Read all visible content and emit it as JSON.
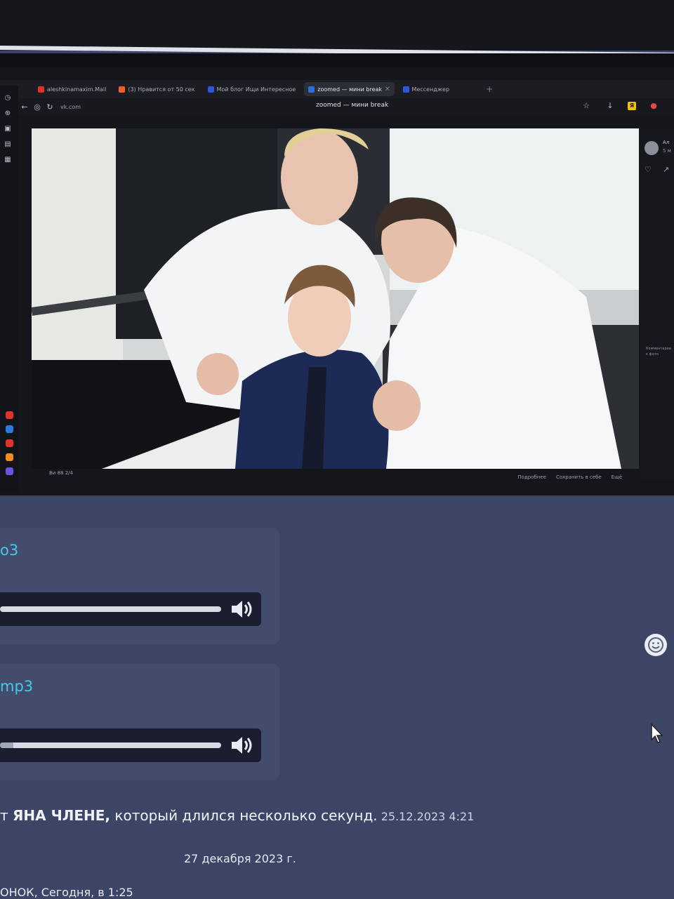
{
  "browser": {
    "tabs": [
      {
        "label": "aleshkinamaxim.Mail",
        "color": "#e0312b",
        "active": false
      },
      {
        "label": "(3) Нравится от 50 сек",
        "color": "#ff5a2a",
        "active": false
      },
      {
        "label": "Мой блог Ищи Интересное",
        "color": "#2a58e0",
        "active": false
      },
      {
        "label": "zoomed — мини break",
        "color": "#2a6ee0",
        "active": true
      },
      {
        "label": "Мессенджер",
        "color": "#2a58e0",
        "active": false
      }
    ],
    "url": "vk.com",
    "page_title": "zoomed — мини break",
    "new_tab_icon": "plus-icon"
  },
  "viewer": {
    "footer_left": "Ви 88 2/4",
    "footer_actions": [
      "Подробнее",
      "Сохранить в себе",
      "Ещё"
    ],
    "side_name": "Ал",
    "side_sub": "5 м",
    "side_text": "Комментарии к фото"
  },
  "chat": {
    "audio1": {
      "title": "o3",
      "progress": 0.0
    },
    "audio2": {
      "title": "mp3",
      "progress": 0.06
    },
    "message": {
      "prefix": "т",
      "bold": "ЯНА ЧЛЕНЕ,",
      "rest": " который длился несколько секунд.",
      "time": " 25.12.2023 4:21"
    },
    "date_separator": "27 декабря 2023 г.",
    "next_author": "ОНОК, Сегодня, в 1:25"
  },
  "colors": {
    "accent_link": "#43cbe6",
    "chat_bg": "#3d4566"
  }
}
